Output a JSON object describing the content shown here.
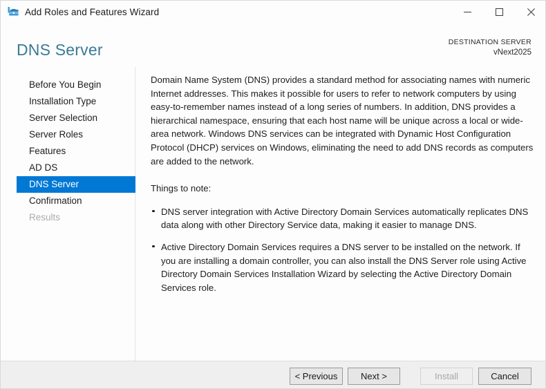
{
  "window": {
    "title": "Add Roles and Features Wizard",
    "app_icon": "server-toolbox-icon",
    "controls": {
      "minimize": "minimize-icon",
      "maximize": "maximize-icon",
      "close": "close-icon"
    }
  },
  "header": {
    "page_title": "DNS Server",
    "destination_label": "DESTINATION SERVER",
    "destination_value": "vNext2025",
    "title_color": "#3a7a96"
  },
  "sidebar": {
    "items": [
      {
        "label": "Before You Begin",
        "state": "normal"
      },
      {
        "label": "Installation Type",
        "state": "normal"
      },
      {
        "label": "Server Selection",
        "state": "normal"
      },
      {
        "label": "Server Roles",
        "state": "normal"
      },
      {
        "label": "Features",
        "state": "normal"
      },
      {
        "label": "AD DS",
        "state": "normal"
      },
      {
        "label": "DNS Server",
        "state": "selected"
      },
      {
        "label": "Confirmation",
        "state": "normal"
      },
      {
        "label": "Results",
        "state": "disabled"
      }
    ],
    "selected_color": "#0078d4"
  },
  "content": {
    "intro": "Domain Name System (DNS) provides a standard method for associating names with numeric Internet addresses. This makes it possible for users to refer to network computers by using easy-to-remember names instead of a long series of numbers. In addition, DNS provides a hierarchical namespace, ensuring that each host name will be unique across a local or wide-area network. Windows DNS services can be integrated with Dynamic Host Configuration Protocol (DHCP) services on Windows, eliminating the need to add DNS records as computers are added to the network.",
    "notes_heading": "Things to note:",
    "notes": [
      "DNS server integration with Active Directory Domain Services automatically replicates DNS data along with other Directory Service data, making it easier to manage DNS.",
      "Active Directory Domain Services requires a DNS server to be installed on the network. If you are installing a domain controller, you can also install the DNS Server role using Active Directory Domain Services Installation Wizard by selecting the Active Directory Domain Services role."
    ]
  },
  "footer": {
    "previous_label": "< Previous",
    "next_label": "Next >",
    "install_label": "Install",
    "install_enabled": false,
    "cancel_label": "Cancel"
  }
}
